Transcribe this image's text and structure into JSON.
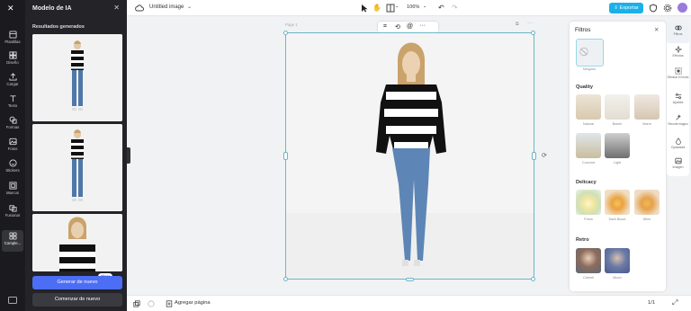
{
  "rail": {
    "items": [
      {
        "label": "Plantillas",
        "icon": "template-icon"
      },
      {
        "label": "Diseño",
        "icon": "design-icon"
      },
      {
        "label": "Cargar",
        "icon": "upload-icon"
      },
      {
        "label": "Texto",
        "icon": "text-icon"
      },
      {
        "label": "Formas",
        "icon": "shapes-icon"
      },
      {
        "label": "Fotos",
        "icon": "photos-icon"
      },
      {
        "label": "Stickers",
        "icon": "stickers-icon"
      },
      {
        "label": "Marcos",
        "icon": "frames-icon"
      },
      {
        "label": "Fusionar",
        "icon": "merge-icon"
      },
      {
        "label": "Comple...",
        "icon": "plugins-icon"
      }
    ]
  },
  "panel": {
    "title": "Modelo de IA",
    "subtitle": "Resultados generados",
    "badge": "Cloro",
    "generate_label": "Generar de nuevo",
    "start_label": "Comenzar de nuevo"
  },
  "topbar": {
    "doc_title": "Untitled image",
    "zoom": "106%",
    "export_label": "Exportar"
  },
  "canvas": {
    "page_label": "Page 1"
  },
  "bottombar": {
    "add_page_label": "Agregar página",
    "page_count": "1/1"
  },
  "filters": {
    "title": "Filtros",
    "none_label": "Ninguno",
    "sections": [
      {
        "title": "Quality",
        "items": [
          "Natural",
          "Bokeh",
          "Warm",
          "Coconut",
          "Light"
        ]
      },
      {
        "title": "Delicacy",
        "items": [
          "Fresh",
          "Dark Blood",
          "Wine"
        ]
      },
      {
        "title": "Retro",
        "items": [
          "Carmel",
          "Moon"
        ]
      }
    ]
  },
  "right_rail": {
    "items": [
      "Filtros",
      "Efectos",
      "Eliminar el fondo",
      "Ajustes",
      "Recorte mágico",
      "Opacidad",
      "Imagen"
    ]
  },
  "colors": {
    "accent": "#1bb0e8",
    "primary_button": "#4c6ef5",
    "dark_panel": "#232328"
  }
}
